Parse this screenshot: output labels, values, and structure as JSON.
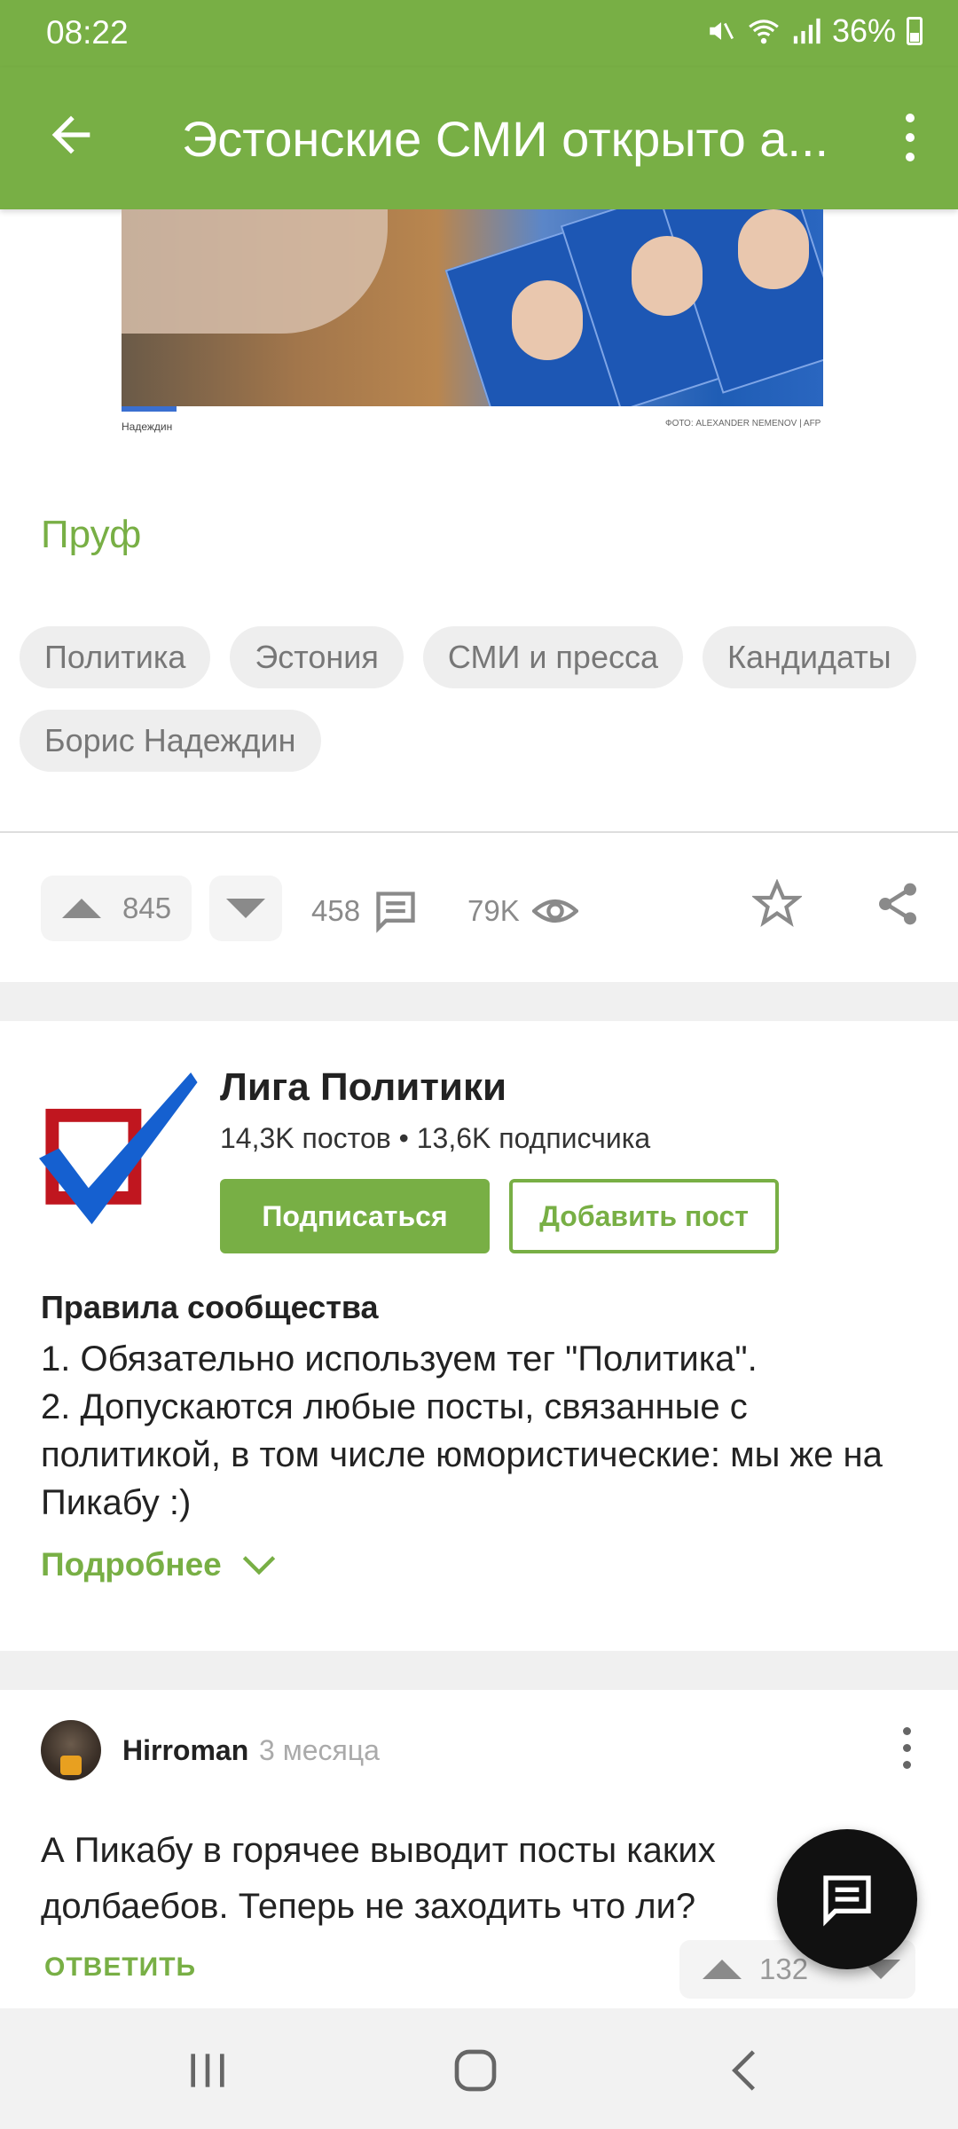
{
  "status_bar": {
    "time": "08:22",
    "battery": "36%"
  },
  "toolbar": {
    "title": "Эстонские СМИ открыто а..."
  },
  "post": {
    "image_caption_left": "Надеждин",
    "image_caption_right": "ФОТО: ALEXANDER NEMENOV | AFP",
    "proof_link": "Пруф",
    "tags": [
      "Политика",
      "Эстония",
      "СМИ и пресса",
      "Кандидаты",
      "Борис Надеждин"
    ],
    "upvotes": "845",
    "comments": "458",
    "views": "79K"
  },
  "community": {
    "name": "Лига Политики",
    "stats": "14,3K постов • 13,6K подписчика",
    "subscribe_label": "Подписаться",
    "add_post_label": "Добавить пост",
    "rules_title": "Правила сообщества",
    "rules_lines": [
      "1. Обязательно используем тег \"Политика\".",
      "2. Допускаются любые посты, связанные с политикой, в том числе юмористические: мы же на Пикабу :)"
    ],
    "more_label": "Подробнее"
  },
  "comment": {
    "author": "Hirroman",
    "time": "3 месяца",
    "text": "А Пикабу в горячее выводит посты каких долбаебов. Теперь не заходить что ли?",
    "reply_label": "ОТВЕТИТЬ",
    "votes": "132"
  },
  "colors": {
    "brand_green": "#78af45",
    "logo_red": "#c0161f",
    "logo_blue": "#1560d0"
  },
  "icons": [
    "back-arrow-icon",
    "more-vert-icon",
    "arrow-up-icon",
    "arrow-down-icon",
    "comment-icon",
    "eye-icon",
    "star-icon",
    "share-icon",
    "chevron-down-icon",
    "chat-icon",
    "recent-apps-icon",
    "home-icon",
    "back-icon"
  ]
}
